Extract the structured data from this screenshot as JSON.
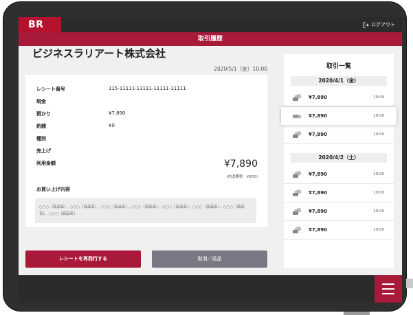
{
  "header": {
    "logo": "BR",
    "logout_label": "ログアウト",
    "page_title": "取引履歴"
  },
  "detail": {
    "company": "ビジネスラリアート株式会社",
    "datetime": "2020/5/1（金）10:00",
    "rows": [
      {
        "label": "レシート番号",
        "value": "115-11111-11111-11111-11111"
      },
      {
        "label": "現金",
        "value": ""
      },
      {
        "label": "預かり",
        "value": "¥7,890"
      },
      {
        "label": "釣銭",
        "value": "¥0"
      },
      {
        "label": "種別",
        "value": ""
      },
      {
        "label": "売上げ",
        "value": ""
      },
      {
        "label": "利用金額",
        "value": ""
      }
    ],
    "total": "¥7,890",
    "tax_note": "(内消費税　¥800)",
    "items_heading": "お買い上げ内容",
    "items_text": "○○○（商品名）、○○○（商品名）、○○○（商品名）、○○○（商品名）、○○○（商品名）、○○○（商品名）、○○○（商品名）、○○○（商品名）"
  },
  "actions": {
    "reissue_label": "レシートを再発行する",
    "cancel_label": "取消／返品"
  },
  "transactions": {
    "title": "取引一覧",
    "groups": [
      {
        "date": "2020/4/1（金）",
        "items": [
          {
            "amount": "¥7,890",
            "time": "10:00",
            "icon": "card-icon",
            "selected": false
          },
          {
            "amount": "¥7,890",
            "time": "10:00",
            "icon": "cash-icon",
            "selected": true
          },
          {
            "amount": "¥7,890",
            "time": "10:00",
            "icon": "card-icon",
            "selected": false
          }
        ]
      },
      {
        "date": "2020/4/2（土）",
        "items": [
          {
            "amount": "¥7,890",
            "time": "10:00",
            "icon": "card-icon",
            "selected": false
          },
          {
            "amount": "¥7,890",
            "time": "10:00",
            "icon": "card-icon",
            "selected": false
          },
          {
            "amount": "¥7,890",
            "time": "10:00",
            "icon": "card-icon",
            "selected": false
          },
          {
            "amount": "¥7,890",
            "time": "10:00",
            "icon": "card-icon",
            "selected": false
          }
        ]
      }
    ]
  },
  "colors": {
    "brand": "#a8193a",
    "logo_bg": "#b5122e",
    "bar": "#2b2b2b",
    "secondary_button": "#7a7884"
  }
}
